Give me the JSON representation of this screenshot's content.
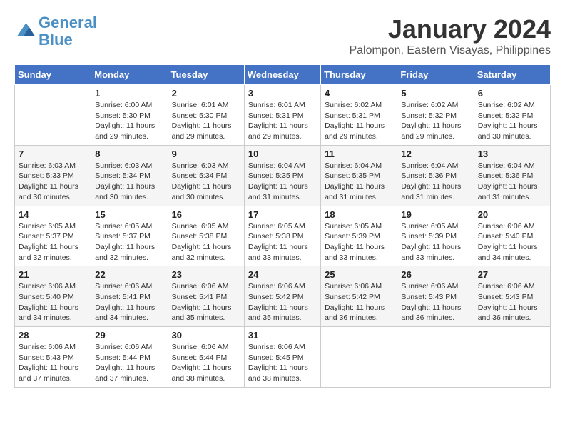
{
  "header": {
    "logo_line1": "General",
    "logo_line2": "Blue",
    "month_title": "January 2024",
    "subtitle": "Palompon, Eastern Visayas, Philippines"
  },
  "calendar": {
    "days_of_week": [
      "Sunday",
      "Monday",
      "Tuesday",
      "Wednesday",
      "Thursday",
      "Friday",
      "Saturday"
    ],
    "weeks": [
      [
        {
          "day": "",
          "info": ""
        },
        {
          "day": "1",
          "info": "Sunrise: 6:00 AM\nSunset: 5:30 PM\nDaylight: 11 hours\nand 29 minutes."
        },
        {
          "day": "2",
          "info": "Sunrise: 6:01 AM\nSunset: 5:30 PM\nDaylight: 11 hours\nand 29 minutes."
        },
        {
          "day": "3",
          "info": "Sunrise: 6:01 AM\nSunset: 5:31 PM\nDaylight: 11 hours\nand 29 minutes."
        },
        {
          "day": "4",
          "info": "Sunrise: 6:02 AM\nSunset: 5:31 PM\nDaylight: 11 hours\nand 29 minutes."
        },
        {
          "day": "5",
          "info": "Sunrise: 6:02 AM\nSunset: 5:32 PM\nDaylight: 11 hours\nand 29 minutes."
        },
        {
          "day": "6",
          "info": "Sunrise: 6:02 AM\nSunset: 5:32 PM\nDaylight: 11 hours\nand 30 minutes."
        }
      ],
      [
        {
          "day": "7",
          "info": "Sunrise: 6:03 AM\nSunset: 5:33 PM\nDaylight: 11 hours\nand 30 minutes."
        },
        {
          "day": "8",
          "info": "Sunrise: 6:03 AM\nSunset: 5:34 PM\nDaylight: 11 hours\nand 30 minutes."
        },
        {
          "day": "9",
          "info": "Sunrise: 6:03 AM\nSunset: 5:34 PM\nDaylight: 11 hours\nand 30 minutes."
        },
        {
          "day": "10",
          "info": "Sunrise: 6:04 AM\nSunset: 5:35 PM\nDaylight: 11 hours\nand 31 minutes."
        },
        {
          "day": "11",
          "info": "Sunrise: 6:04 AM\nSunset: 5:35 PM\nDaylight: 11 hours\nand 31 minutes."
        },
        {
          "day": "12",
          "info": "Sunrise: 6:04 AM\nSunset: 5:36 PM\nDaylight: 11 hours\nand 31 minutes."
        },
        {
          "day": "13",
          "info": "Sunrise: 6:04 AM\nSunset: 5:36 PM\nDaylight: 11 hours\nand 31 minutes."
        }
      ],
      [
        {
          "day": "14",
          "info": "Sunrise: 6:05 AM\nSunset: 5:37 PM\nDaylight: 11 hours\nand 32 minutes."
        },
        {
          "day": "15",
          "info": "Sunrise: 6:05 AM\nSunset: 5:37 PM\nDaylight: 11 hours\nand 32 minutes."
        },
        {
          "day": "16",
          "info": "Sunrise: 6:05 AM\nSunset: 5:38 PM\nDaylight: 11 hours\nand 32 minutes."
        },
        {
          "day": "17",
          "info": "Sunrise: 6:05 AM\nSunset: 5:38 PM\nDaylight: 11 hours\nand 33 minutes."
        },
        {
          "day": "18",
          "info": "Sunrise: 6:05 AM\nSunset: 5:39 PM\nDaylight: 11 hours\nand 33 minutes."
        },
        {
          "day": "19",
          "info": "Sunrise: 6:05 AM\nSunset: 5:39 PM\nDaylight: 11 hours\nand 33 minutes."
        },
        {
          "day": "20",
          "info": "Sunrise: 6:06 AM\nSunset: 5:40 PM\nDaylight: 11 hours\nand 34 minutes."
        }
      ],
      [
        {
          "day": "21",
          "info": "Sunrise: 6:06 AM\nSunset: 5:40 PM\nDaylight: 11 hours\nand 34 minutes."
        },
        {
          "day": "22",
          "info": "Sunrise: 6:06 AM\nSunset: 5:41 PM\nDaylight: 11 hours\nand 34 minutes."
        },
        {
          "day": "23",
          "info": "Sunrise: 6:06 AM\nSunset: 5:41 PM\nDaylight: 11 hours\nand 35 minutes."
        },
        {
          "day": "24",
          "info": "Sunrise: 6:06 AM\nSunset: 5:42 PM\nDaylight: 11 hours\nand 35 minutes."
        },
        {
          "day": "25",
          "info": "Sunrise: 6:06 AM\nSunset: 5:42 PM\nDaylight: 11 hours\nand 36 minutes."
        },
        {
          "day": "26",
          "info": "Sunrise: 6:06 AM\nSunset: 5:43 PM\nDaylight: 11 hours\nand 36 minutes."
        },
        {
          "day": "27",
          "info": "Sunrise: 6:06 AM\nSunset: 5:43 PM\nDaylight: 11 hours\nand 36 minutes."
        }
      ],
      [
        {
          "day": "28",
          "info": "Sunrise: 6:06 AM\nSunset: 5:43 PM\nDaylight: 11 hours\nand 37 minutes."
        },
        {
          "day": "29",
          "info": "Sunrise: 6:06 AM\nSunset: 5:44 PM\nDaylight: 11 hours\nand 37 minutes."
        },
        {
          "day": "30",
          "info": "Sunrise: 6:06 AM\nSunset: 5:44 PM\nDaylight: 11 hours\nand 38 minutes."
        },
        {
          "day": "31",
          "info": "Sunrise: 6:06 AM\nSunset: 5:45 PM\nDaylight: 11 hours\nand 38 minutes."
        },
        {
          "day": "",
          "info": ""
        },
        {
          "day": "",
          "info": ""
        },
        {
          "day": "",
          "info": ""
        }
      ]
    ]
  }
}
